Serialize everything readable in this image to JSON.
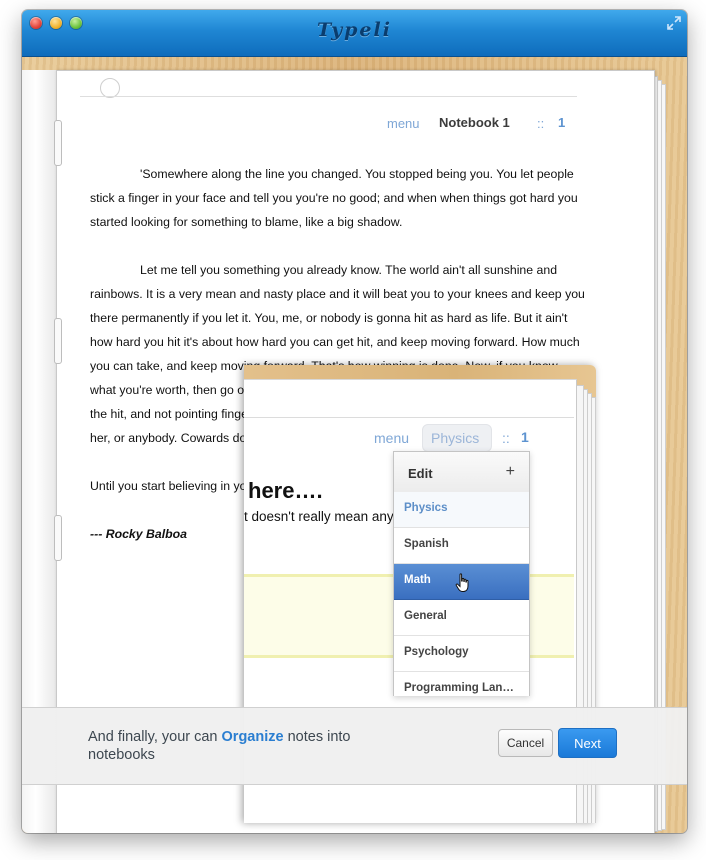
{
  "window": {
    "app_title": "Typeli"
  },
  "notebook": {
    "menu_label": "menu",
    "title": "Notebook 1",
    "separator": "::",
    "page_number": "1",
    "paragraphs": [
      "'Somewhere along the line you changed. You stopped being you. You let people stick a finger in your face and tell you you're no good; and when when things got hard you started looking for something to blame, like a big shadow.",
      "Let me tell you something you already know. The world ain't all sunshine and rainbows. It is a very mean and nasty place and it will beat you to your knees and keep you there permanently if you let it. You, me, or nobody is gonna hit as hard as life. But it ain't how hard you hit it's about how hard you can get hit, and keep moving forward. How much you can take, and keep moving forward. That's how winning is done. Now, if you know what you're worth, then go out and get what you're worth. But you gotta be willing to take the hit, and not pointing fingers saying you ain't where you wanna be because of him, or her, or anybody. Cowards do that and that ain't you. You're better than that!",
      "Until you start believing in yourself, you ain't gonna have a life.'"
    ],
    "signature": "--- Rocky Balboa"
  },
  "inset": {
    "menu_label": "menu",
    "current_notebook": "Physics",
    "separator": "::",
    "page_number": "1",
    "heading": "here….",
    "line": "t doesn't really mean anyt",
    "dropdown": {
      "edit_label": "Edit",
      "add_label": "+",
      "items": [
        "Physics",
        "Spanish",
        "Math",
        "General",
        "Psychology",
        "Programming Lan…"
      ]
    }
  },
  "footer": {
    "message_before": "And finally, your can ",
    "message_highlight": "Organize",
    "message_after": " notes into notebooks",
    "cancel_label": "Cancel",
    "next_label": "Next"
  },
  "colors": {
    "titlebar": "#1f86d3",
    "accent": "#2a7ed1",
    "link": "#7fa7d6",
    "selected_item": "#3a6fc0",
    "wood": "#dcb47b"
  }
}
